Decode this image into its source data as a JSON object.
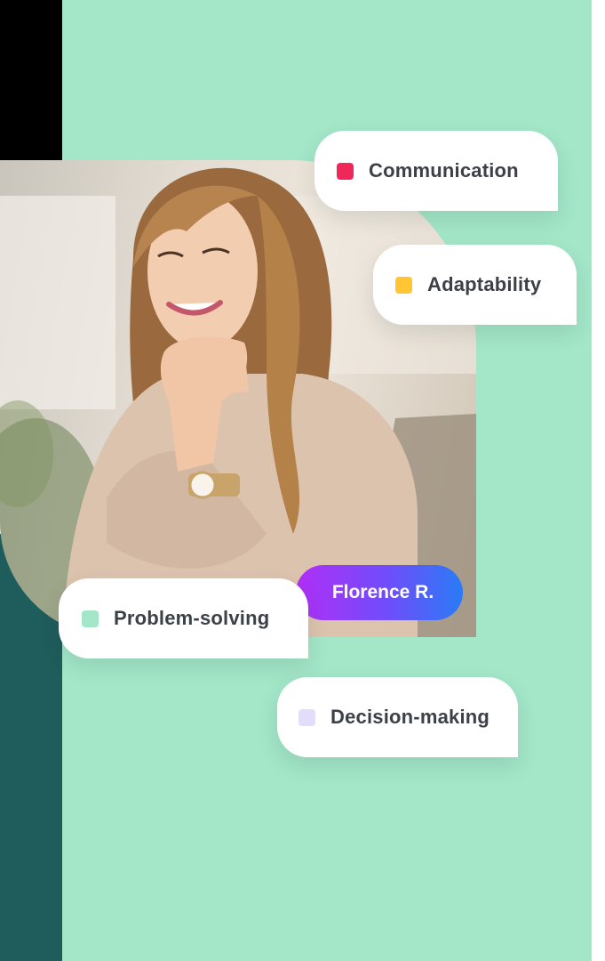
{
  "profile": {
    "name": "Florence R.",
    "photo_alt": "smiling woman resting chin on hand"
  },
  "skills": [
    {
      "label": "Communication",
      "color": "#f0285a"
    },
    {
      "label": "Adaptability",
      "color": "#ffc533"
    },
    {
      "label": "Problem-solving",
      "color": "#a3e6c8"
    },
    {
      "label": "Decision-making",
      "color": "#e4dcfb"
    }
  ],
  "colors": {
    "mint": "#a3e6c8",
    "teal": "#1f5c5c",
    "pill_gradient_start": "#b12ff7",
    "pill_gradient_end": "#2a7bf6"
  }
}
